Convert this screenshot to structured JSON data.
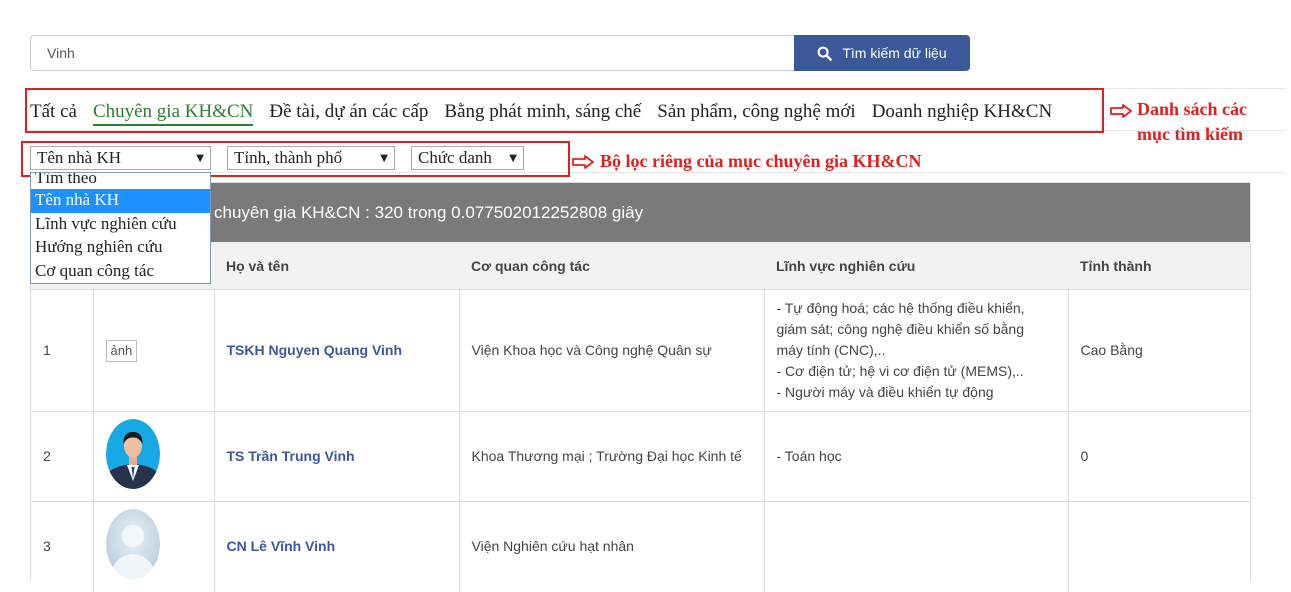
{
  "search": {
    "value": "Vinh",
    "button_label": "Tìm kiếm dữ liệu",
    "button_color": "#3b5998"
  },
  "tabs": [
    {
      "label": "Tất cả",
      "active": false
    },
    {
      "label": "Chuyên gia KH&CN",
      "active": true
    },
    {
      "label": "Đề tài, dự án các cấp",
      "active": false
    },
    {
      "label": "Bằng phát minh, sáng chế",
      "active": false
    },
    {
      "label": "Sản phẩm, công nghệ mới",
      "active": false
    },
    {
      "label": "Doanh nghiệp KH&CN",
      "active": false
    }
  ],
  "filters": {
    "field": "Tên nhà KH",
    "province": "Tỉnh, thành phố",
    "title": "Chức danh"
  },
  "dropdown_options": [
    "Tìm theo",
    "Tên nhà KH",
    "Lĩnh vực nghiên cứu",
    "Hướng nghiên cứu",
    "Cơ quan công tác"
  ],
  "dropdown_selected": "Tên nhà KH",
  "annotations": {
    "tabs_note_line1": "Danh sách các",
    "tabs_note_line2": "mục tìm kiếm",
    "filters_note": "Bộ lọc riêng của mục chuyên gia KH&CN",
    "annotation_color": "#e02020"
  },
  "results": {
    "summary": "chuyên gia KH&CN : 320 trong 0.077502012252808 giây",
    "columns": [
      "",
      "",
      "Họ và tên",
      "Cơ quan công tác",
      "Lĩnh vực nghiên cứu",
      "Tỉnh thành"
    ],
    "rows": [
      {
        "index": "1",
        "photo_alt": "ảnh",
        "name": "TSKH Nguyen Quang Vinh",
        "agency": "Viện Khoa học và Công nghệ Quân sự",
        "fields": [
          "- Tự động hoá; các hệ thống điều khiển,",
          "giám sát; công nghệ điều khiển số bằng",
          "máy tính (CNC),..",
          "- Cơ điện tử; hệ vi cơ điện tử (MEMS),..",
          "- Người máy và điều khiển tự động"
        ],
        "province": "Cao Bằng"
      },
      {
        "index": "2",
        "photo_alt": "",
        "name": "TS Trần Trung Vinh",
        "agency": "Khoa Thương mại ; Trường Đại học Kinh tế",
        "fields": [
          "- Toán học"
        ],
        "province": "0"
      },
      {
        "index": "3",
        "photo_alt": "",
        "name": "CN Lê Vĩnh Vinh",
        "agency": "Viện Nghiên cứu hạt nhân",
        "fields": [],
        "province": ""
      }
    ]
  }
}
